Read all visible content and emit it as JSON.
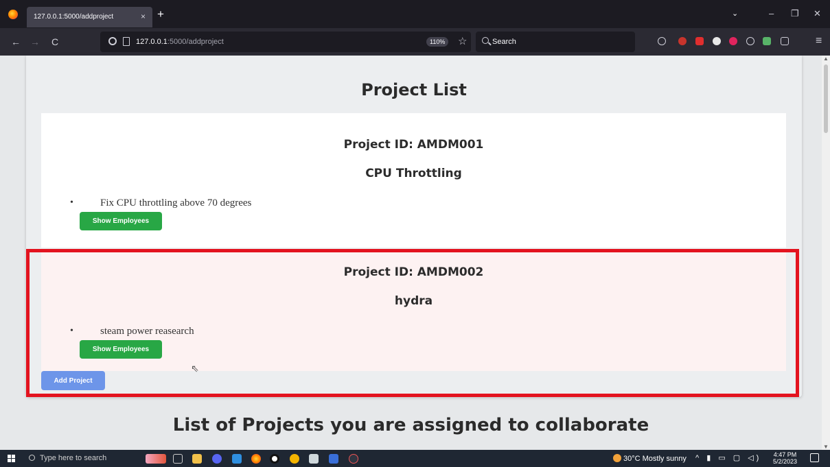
{
  "browser": {
    "tab_title": "127.0.0.1:5000/addproject",
    "tab_close": "×",
    "new_tab": "+",
    "tab_list": "⌄",
    "win_min": "–",
    "win_restore": "❐",
    "win_close": "✕",
    "back": "←",
    "forward": "→",
    "reload": "C",
    "url_host": "127.0.0.1",
    "url_path": ":5000/addproject",
    "zoom": "110%",
    "bookmark": "☆",
    "search_placeholder": "Search",
    "menu": "≡"
  },
  "page": {
    "title": "Project List",
    "projects": [
      {
        "id_label": "Project ID: AMDM001",
        "name": "CPU Throttling",
        "bullet": "•",
        "description": "Fix CPU throttling above 70 degrees",
        "button": "Show Employees"
      },
      {
        "id_label": "Project ID: AMDM002",
        "name": "hydra",
        "bullet": "•",
        "description": "steam power reasearch",
        "button": "Show Employees"
      }
    ],
    "add_button": "Add Project",
    "section_title": "List of Projects you are assigned to collaborate"
  },
  "taskbar": {
    "search_placeholder": "Type here to search",
    "weather": "30°C  Mostly sunny",
    "time": "4:47 PM",
    "date": "5/2/2023"
  },
  "colors": {
    "highlight": "#e3131f",
    "green_button": "#28a745",
    "blue_button": "#6d95e9"
  }
}
